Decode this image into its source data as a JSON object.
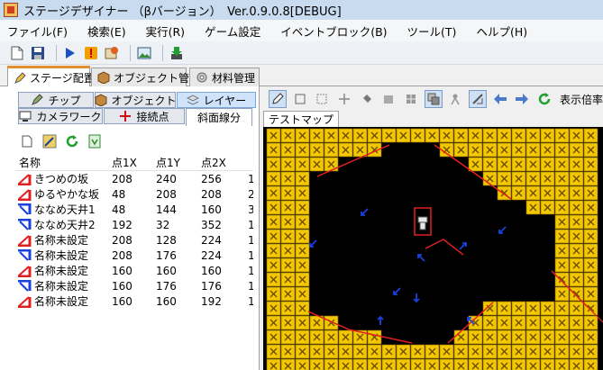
{
  "window": {
    "title": "ステージデザイナー （βバージョン）　Ver.0.9.0.8[DEBUG]"
  },
  "menu": [
    "ファイル(F)",
    "検索(E)",
    "実行(R)",
    "ゲーム設定",
    "イベントブロック(B)",
    "ツール(T)",
    "ヘルプ(H)"
  ],
  "main_tabs": {
    "stage": "ステージ配置",
    "object": "オブジェクト管理",
    "material": "材料管理"
  },
  "sub_tabs": {
    "chip": "チップ",
    "object": "オブジェクト",
    "layer": "レイヤー",
    "camera": "カメラワーク",
    "connect": "接続点",
    "slope": "斜面線分"
  },
  "list": {
    "headers": [
      "名称",
      "点1X",
      "点1Y",
      "点2X"
    ],
    "rows": [
      {
        "icon": "slope-up-red-icon",
        "name": "きつめの坂",
        "x1": "208",
        "y1": "240",
        "x2": "256",
        "extra": "1"
      },
      {
        "icon": "slope-up-red-icon",
        "name": "ゆるやかな坂",
        "x1": "48",
        "y1": "208",
        "x2": "208",
        "extra": "2"
      },
      {
        "icon": "ceiling-blue-icon",
        "name": "ななめ天井1",
        "x1": "48",
        "y1": "144",
        "x2": "160",
        "extra": "3"
      },
      {
        "icon": "ceiling-blue-icon",
        "name": "ななめ天井2",
        "x1": "192",
        "y1": "32",
        "x2": "352",
        "extra": "1"
      },
      {
        "icon": "slope-up-red-icon",
        "name": "名称未設定",
        "x1": "208",
        "y1": "128",
        "x2": "224",
        "extra": "1"
      },
      {
        "icon": "ceiling-blue-icon",
        "name": "名称未設定",
        "x1": "208",
        "y1": "176",
        "x2": "224",
        "extra": "1"
      },
      {
        "icon": "slope-up-red-icon",
        "name": "名称未設定",
        "x1": "160",
        "y1": "160",
        "x2": "160",
        "extra": "1"
      },
      {
        "icon": "ceiling-blue-icon",
        "name": "名称未設定",
        "x1": "160",
        "y1": "176",
        "x2": "176",
        "extra": "1"
      },
      {
        "icon": "slope-up-red-icon",
        "name": "名称未設定",
        "x1": "160",
        "y1": "160",
        "x2": "192",
        "extra": "1"
      }
    ]
  },
  "editor": {
    "zoom_label": "表示倍率",
    "map_tab": "テストマップ"
  },
  "colors": {
    "tile_yellow": "#f2c600",
    "slope_red": "#e02020",
    "ceiling_blue": "#1a40e0",
    "tab_accent": "#e09030",
    "selected_tab": "#cfe4fb"
  }
}
